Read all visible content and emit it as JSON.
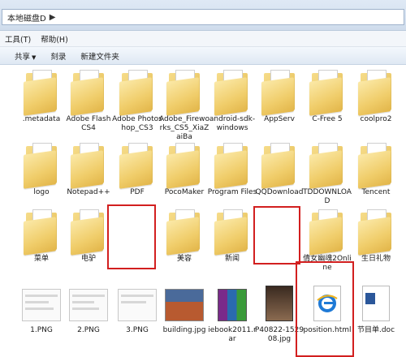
{
  "address": {
    "path": "本地磁盘D"
  },
  "menu": [
    "工具(T)",
    "帮助(H)"
  ],
  "toolbar": {
    "share": "共享",
    "burn": "刻录",
    "new_folder": "新建文件夹"
  },
  "files": [
    {
      "label": ".metadata",
      "kind": "folder"
    },
    {
      "label": "Adobe Flash CS4",
      "kind": "folder"
    },
    {
      "label": "Adobe Photoshop_CS3",
      "kind": "folder"
    },
    {
      "label": "Adobe_Fireworks_CS5_XiaZaiBa",
      "kind": "folder"
    },
    {
      "label": "android-sdk-windows",
      "kind": "folder"
    },
    {
      "label": "AppServ",
      "kind": "folder"
    },
    {
      "label": "C-Free 5",
      "kind": "folder"
    },
    {
      "label": "coolpro2",
      "kind": "folder"
    },
    {
      "label": "logo",
      "kind": "folder"
    },
    {
      "label": "Notepad++",
      "kind": "folder"
    },
    {
      "label": "PDF",
      "kind": "folder"
    },
    {
      "label": "PocoMaker",
      "kind": "folder"
    },
    {
      "label": "Program Files",
      "kind": "folder"
    },
    {
      "label": "QQDownload",
      "kind": "folder"
    },
    {
      "label": "TDDOWNLOAD",
      "kind": "folder"
    },
    {
      "label": "Tencent",
      "kind": "folder"
    },
    {
      "label": "菜单",
      "kind": "folder"
    },
    {
      "label": "电驴",
      "kind": "folder"
    },
    {
      "label": "美容",
      "kind": "folder"
    },
    {
      "label": "新闻",
      "kind": "folder"
    },
    {
      "label": "倩女幽魂2Online",
      "kind": "folder"
    },
    {
      "label": "生日礼物",
      "kind": "folder"
    },
    {
      "label": "1.PNG",
      "kind": "image"
    },
    {
      "label": "2.PNG",
      "kind": "image"
    },
    {
      "label": "3.PNG",
      "kind": "image"
    },
    {
      "label": "building.jpg",
      "kind": "photo"
    },
    {
      "label": "iebook2011.rar",
      "kind": "rar"
    },
    {
      "label": "P40822-152908.jpg",
      "kind": "photo"
    },
    {
      "label": "position.html",
      "kind": "html"
    },
    {
      "label": "节目单.doc",
      "kind": "doc"
    }
  ]
}
